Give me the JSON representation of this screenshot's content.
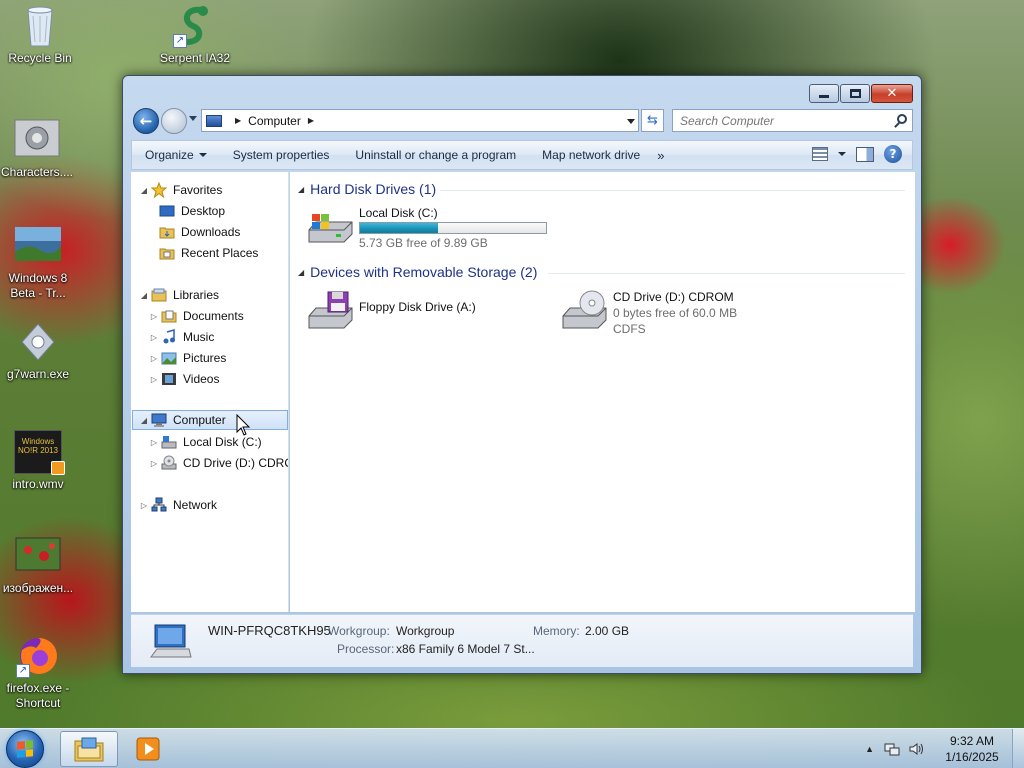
{
  "desktop": {
    "icons": [
      {
        "name": "recycle-bin",
        "label": "Recycle Bin"
      },
      {
        "name": "serpent",
        "label": "Serpent IA32"
      },
      {
        "name": "characters",
        "label": "Characters...."
      },
      {
        "name": "windows8",
        "label": "Windows 8 Beta - Tr..."
      },
      {
        "name": "g7warn",
        "label": "g7warn.exe"
      },
      {
        "name": "intro",
        "label": "intro.wmv"
      },
      {
        "name": "image",
        "label": "изображен..."
      },
      {
        "name": "firefox",
        "label": "firefox.exe - Shortcut"
      }
    ],
    "intro_thumb_text": "Windows NO!R 2013"
  },
  "window": {
    "address": {
      "crumb": "Computer"
    },
    "search": {
      "placeholder": "Search Computer"
    },
    "toolbar": {
      "organize": "Organize",
      "system_properties": "System properties",
      "uninstall": "Uninstall or change a program",
      "map_drive": "Map network drive",
      "more": "»"
    },
    "nav": {
      "favorites": "Favorites",
      "desktop": "Desktop",
      "downloads": "Downloads",
      "recent": "Recent Places",
      "libraries": "Libraries",
      "documents": "Documents",
      "music": "Music",
      "pictures": "Pictures",
      "videos": "Videos",
      "computer": "Computer",
      "local_disk": "Local Disk (C:)",
      "cd_drive": "CD Drive (D:) CDROM",
      "network": "Network"
    },
    "content": {
      "hdd_header": "Hard Disk Drives (1)",
      "removable_header": "Devices with Removable Storage (2)",
      "local_disk": {
        "name": "Local Disk (C:)",
        "free": "5.73 GB free of 9.89 GB",
        "used_fraction": 0.42
      },
      "floppy": {
        "name": "Floppy Disk Drive (A:)"
      },
      "cdrom": {
        "name": "CD Drive (D:) CDROM",
        "free": "0 bytes free of 60.0 MB",
        "fs": "CDFS"
      }
    },
    "details": {
      "computer_name": "WIN-PFRQC8TKH95",
      "workgroup_label": "Workgroup:",
      "workgroup_value": "Workgroup",
      "memory_label": "Memory:",
      "memory_value": "2.00 GB",
      "processor_label": "Processor:",
      "processor_value": "x86 Family 6 Model 7 St..."
    }
  },
  "taskbar": {
    "time": "9:32 AM",
    "date": "1/16/2025"
  },
  "colors": {
    "accent": "#1e3287",
    "disk_fill": "#1a8fb3",
    "close_red": "#c7402a"
  }
}
